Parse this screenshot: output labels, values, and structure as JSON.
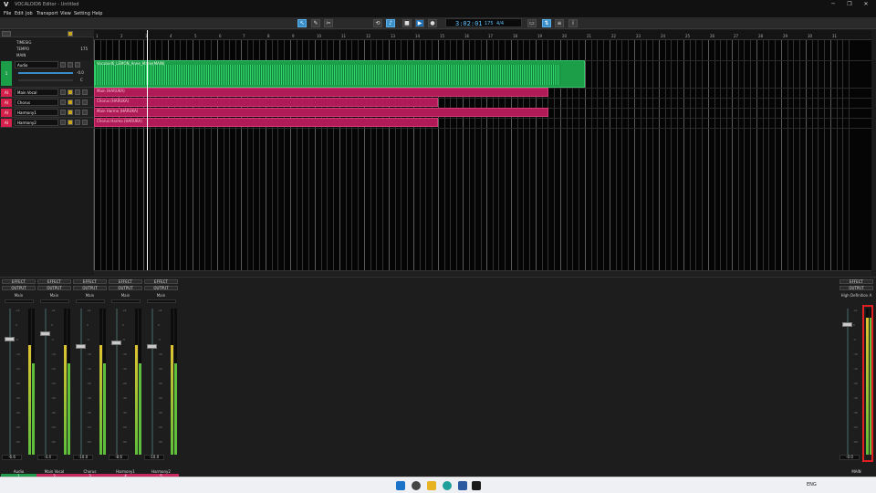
{
  "window": {
    "title": "VOCALOID6 Editor - Untitled",
    "logo": "V",
    "controls": [
      "─",
      "❐",
      "✕"
    ]
  },
  "menu": [
    "File",
    "Edit",
    "Job",
    "Transport",
    "View",
    "Setting",
    "Help"
  ],
  "toolbar": {
    "grid_label": "GRID",
    "grid_value": "1/4",
    "time": "3:02:01",
    "tempo": "175",
    "signature": "4/4"
  },
  "left": {
    "signature_label": "TIMESIG",
    "tempo_label": "TEMPO",
    "tempo_value": "175",
    "main_label": "MAIN",
    "sig_value": "4/4"
  },
  "tracks": [
    {
      "badge": "1",
      "name": "Audio",
      "kind": "audio",
      "vol": "-0.0",
      "pan": "C"
    },
    {
      "badge": "AI",
      "name": "Main Vocal"
    },
    {
      "badge": "AI",
      "name": "Chorus"
    },
    {
      "badge": "AI",
      "name": "Harmony1"
    },
    {
      "badge": "AI",
      "name": "Harmony2"
    }
  ],
  "ruler": [
    "1",
    "2",
    "3",
    "4",
    "5",
    "6",
    "7",
    "8",
    "9",
    "10",
    "11",
    "12",
    "13",
    "14",
    "15",
    "16",
    "17",
    "18",
    "19",
    "20",
    "21",
    "22",
    "23",
    "24",
    "25",
    "26",
    "27",
    "28",
    "29",
    "30",
    "31"
  ],
  "clips": {
    "audio": "Vocaloid6_LEMON_Anne_Marie(MAIN)",
    "vocal": [
      "Main (HARUKA)",
      "Chorus (HARUKA)",
      "Main Harmo (HARUKA)",
      "Chorus Harmo (HARUKA)"
    ]
  },
  "mixer": {
    "effect_label": "EFFECT",
    "output_label": "OUTPUT",
    "main_out": "Main",
    "strips": [
      {
        "name": "Audio",
        "num": "1",
        "db": "-6.6",
        "pan": "C",
        "color": "#1f9a4c"
      },
      {
        "name": "Main Vocal",
        "num": "2",
        "db": "-4.4",
        "pan": "C",
        "color": "#c8285f"
      },
      {
        "name": "Chorus",
        "num": "3",
        "db": "-10.0",
        "pan": "40",
        "color": "#c8285f"
      },
      {
        "name": "Harmony1",
        "num": "4",
        "db": "-8.6",
        "pan": "C",
        "color": "#c8285f"
      },
      {
        "name": "Harmony2",
        "num": "5",
        "db": "-10.0",
        "pan": "-40",
        "color": "#c8285f"
      }
    ],
    "master": {
      "name": "MAIN",
      "db": "-0.0",
      "output": "High Definition A"
    },
    "scale": [
      "+6",
      "0",
      "-5",
      "-10",
      "-15",
      "-20",
      "-30",
      "-40",
      "-50",
      "-60"
    ]
  },
  "taskbar": {
    "lang": "ENG",
    "time": "",
    "icons": [
      "start-icon",
      "search-icon",
      "files-icon",
      "edge-icon",
      "store-icon",
      "vocaloid-icon"
    ]
  }
}
